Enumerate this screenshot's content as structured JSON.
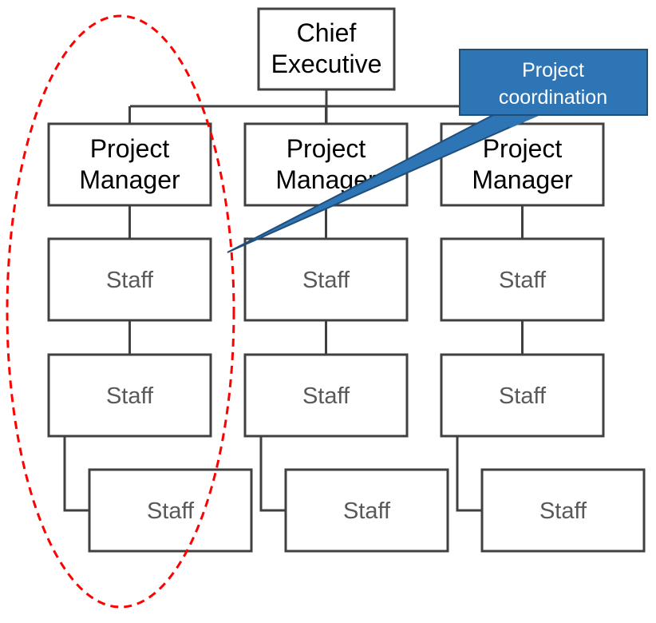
{
  "chief": {
    "line1": "Chief",
    "line2": "Executive"
  },
  "managers": [
    {
      "line1": "Project",
      "line2": "Manager"
    },
    {
      "line1": "Project",
      "line2": "Manager"
    },
    {
      "line1": "Project",
      "line2": "Manager"
    }
  ],
  "staff_label": "Staff",
  "staff_columns": [
    [
      "Staff",
      "Staff",
      "Staff"
    ],
    [
      "Staff",
      "Staff",
      "Staff"
    ],
    [
      "Staff",
      "Staff",
      "Staff"
    ]
  ],
  "callout": {
    "line1": "Project",
    "line2": "coordination",
    "fill": "#2e75b6",
    "stroke": "#1f4e79"
  },
  "highlight": {
    "color": "#ff0000",
    "style": "dashed-ellipse"
  }
}
